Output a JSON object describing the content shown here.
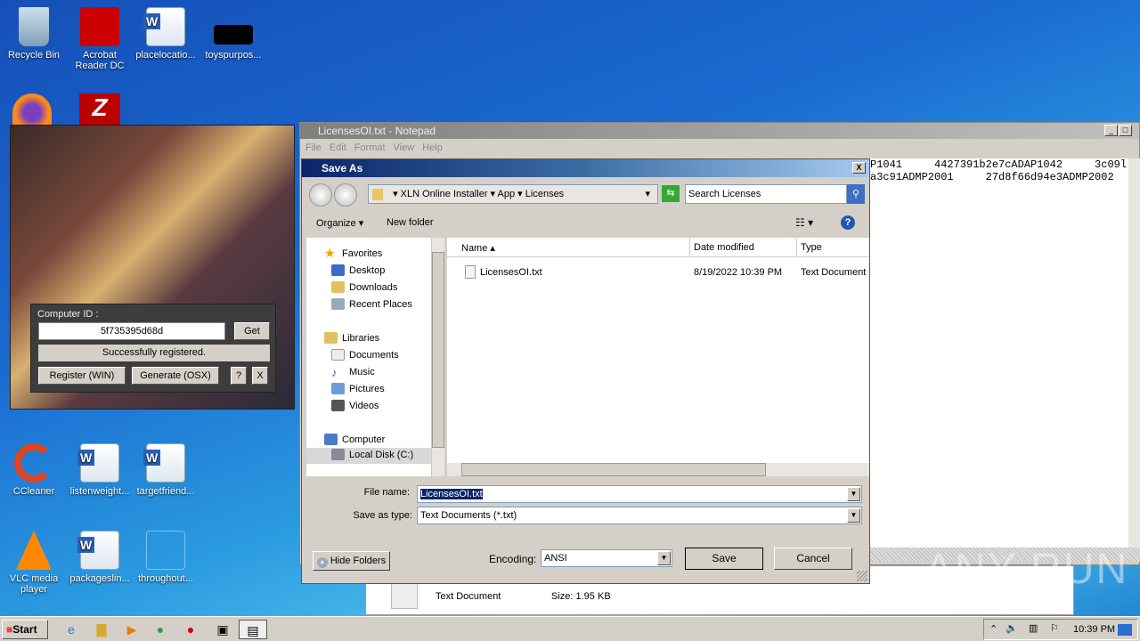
{
  "desktop": {
    "icons": [
      {
        "label": "Recycle Bin",
        "icon": "recycle-bin-icon"
      },
      {
        "label": "Acrobat Reader DC",
        "icon": "acrobat-icon"
      },
      {
        "label": "placelocatio...",
        "icon": "word-doc-icon"
      },
      {
        "label": "toyspurpos...",
        "icon": "black-thumbnail-icon"
      },
      {
        "label": "CCleaner",
        "icon": "ccleaner-icon"
      },
      {
        "label": "listenweight...",
        "icon": "word-doc-icon"
      },
      {
        "label": "targetfriend...",
        "icon": "word-doc-icon"
      },
      {
        "label": "VLC media player",
        "icon": "vlc-icon"
      },
      {
        "label": "packageslin...",
        "icon": "word-doc-icon"
      },
      {
        "label": "throughout...",
        "icon": "blank-file-icon"
      }
    ]
  },
  "keygen": {
    "computer_id_label": "Computer ID :",
    "computer_id": "5f735395d68d",
    "get": "Get",
    "status": "Successfully registered.",
    "register": "Register (WIN)",
    "generate": "Generate (OSX)",
    "help": "?",
    "close": "X"
  },
  "notepad": {
    "title": "LicensesOI.txt - Notepad",
    "menu": [
      "File",
      "Edit",
      "Format",
      "View",
      "Help"
    ],
    "lines": [
      "P1041     4427391b2e7cADAP1042     3c09l",
      "a3c91ADMP2001     27d8f66d94e3ADMP2002"
    ]
  },
  "details": {
    "type": "Text Document",
    "size": "Size: 1.95 KB"
  },
  "save_as": {
    "title": "Save As",
    "breadcrumb": [
      "XLN Online Installer",
      "App",
      "Licenses"
    ],
    "search_placeholder": "Search Licenses",
    "organize": "Organize",
    "new_folder": "New folder",
    "nav": {
      "favorites": "Favorites",
      "fav_items": [
        "Desktop",
        "Downloads",
        "Recent Places"
      ],
      "libraries": "Libraries",
      "lib_items": [
        "Documents",
        "Music",
        "Pictures",
        "Videos"
      ],
      "computer": "Computer",
      "comp_items": [
        "Local Disk (C:)"
      ]
    },
    "columns": [
      "Name",
      "Date modified",
      "Type"
    ],
    "files": [
      {
        "name": "LicensesOI.txt",
        "date": "8/19/2022 10:39 PM",
        "type": "Text Document"
      }
    ],
    "file_name_label": "File name:",
    "file_name": "LicensesOI.txt",
    "save_type_label": "Save as type:",
    "save_type": "Text Documents (*.txt)",
    "hide_folders": "Hide Folders",
    "encoding_label": "Encoding:",
    "encoding": "ANSI",
    "save": "Save",
    "cancel": "Cancel"
  },
  "taskbar": {
    "start": "Start",
    "clock": "10:39 PM"
  },
  "watermark": "ANY RUN"
}
